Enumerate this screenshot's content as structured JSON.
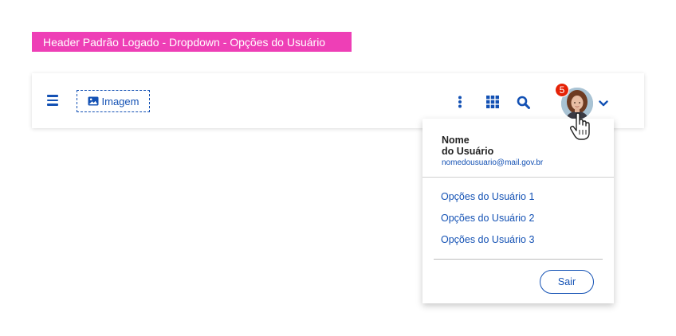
{
  "annotation": {
    "label": "Header Padrão Logado - Dropdown - Opções do Usuário"
  },
  "header": {
    "logo_label": "Imagem",
    "notification_count": "5"
  },
  "dropdown": {
    "user_name_line1": "Nome",
    "user_name_line2": "do Usuário",
    "user_email": "nomedousuario@mail.gov.br",
    "options": [
      {
        "label": "Opções do Usuário 1"
      },
      {
        "label": "Opções do Usuário 2"
      },
      {
        "label": "Opções do Usuário 3"
      }
    ],
    "logout_label": "Sair"
  },
  "colors": {
    "accent": "#1351b4",
    "annotation_bg": "#ee3fb6",
    "badge": "#e52207"
  },
  "icons": [
    "menu-icon",
    "image-icon",
    "kebab-menu-icon",
    "apps-grid-icon",
    "search-icon",
    "chevron-down-icon",
    "hand-cursor-icon"
  ]
}
